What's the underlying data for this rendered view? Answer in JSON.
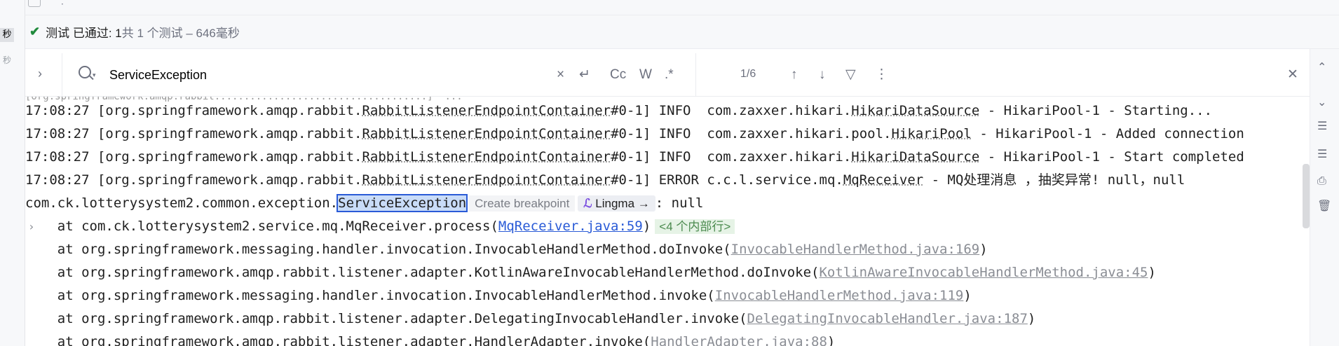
{
  "left_tabs": {
    "active": "秒",
    "inactive": "秒"
  },
  "top_toolbar": {
    "dot": "·"
  },
  "status": {
    "check_icon": "✔",
    "passed": "测试 已通过: 1",
    "detail": "共 1 个测试 – 646毫秒"
  },
  "search": {
    "expand_icon": "›",
    "query": "ServiceException",
    "clear_icon": "×",
    "wrap_icon": "↵",
    "case_label": "Cc",
    "word_label": "W",
    "regex_label": ".*",
    "match_count": "1/6",
    "prev_icon": "↑",
    "next_icon": "↓",
    "filter_icon": "▽",
    "more_icon": "⋮",
    "close_icon": "✕"
  },
  "log": {
    "lines": [
      {
        "time": "17:08:27",
        "pre": "[org.springframework.amqp.rabbit.",
        "cls": "RabbitListenerEndpointContainer",
        "post": "#0-1] ",
        "level": "INFO ",
        "logger_pre": "com.zaxxer.hikari.",
        "logger_cls": "HikariDataSource",
        "msg": " - HikariPool-1 - Starting..."
      },
      {
        "time": "17:08:27",
        "pre": "[org.springframework.amqp.rabbit.",
        "cls": "RabbitListenerEndpointContainer",
        "post": "#0-1] ",
        "level": "INFO ",
        "logger_pre": "com.zaxxer.hikari.pool.",
        "logger_cls": "HikariPool",
        "msg": " - HikariPool-1 - Added connection"
      },
      {
        "time": "17:08:27",
        "pre": "[org.springframework.amqp.rabbit.",
        "cls": "RabbitListenerEndpointContainer",
        "post": "#0-1] ",
        "level": "INFO ",
        "logger_pre": "com.zaxxer.hikari.",
        "logger_cls": "HikariDataSource",
        "msg": " - HikariPool-1 - Start completed"
      },
      {
        "time": "17:08:27",
        "pre": "[org.springframework.amqp.rabbit.",
        "cls": "RabbitListenerEndpointContainer",
        "post": "#0-1] ",
        "level": "ERROR",
        "logger_pre": "c.c.l.service.mq.",
        "logger_cls": "MqReceiver",
        "msg": " - MQ处理消息 ，抽奖异常! null，null"
      }
    ],
    "exception": {
      "pre": "com.ck.lotterysystem2.common.exception.",
      "match": "ServiceException",
      "breakpoint": "Create breakpoint",
      "lingma_icon": "ℒ",
      "lingma": "Lingma →",
      "post": ": null"
    },
    "frames": [
      {
        "at": "    at com.ck.lotterysystem2.service.mq.MqReceiver.process(",
        "src": "MqReceiver.java:59",
        "close": ")",
        "internal": "<4 个内部行>",
        "user_code": true
      },
      {
        "at": "    at org.springframework.messaging.handler.invocation.InvocableHandlerMethod.doInvoke(",
        "src": "InvocableHandlerMethod.java:169",
        "close": ")",
        "user_code": false
      },
      {
        "at": "    at org.springframework.amqp.rabbit.listener.adapter.KotlinAwareInvocableHandlerMethod.doInvoke(",
        "src": "KotlinAwareInvocableHandlerMethod.java:45",
        "close": ")",
        "user_code": false
      },
      {
        "at": "    at org.springframework.messaging.handler.invocation.InvocableHandlerMethod.invoke(",
        "src": "InvocableHandlerMethod.java:119",
        "close": ")",
        "user_code": false
      },
      {
        "at": "    at org.springframework.amqp.rabbit.listener.adapter.DelegatingInvocableHandler.invoke(",
        "src": "DelegatingInvocableHandler.java:187",
        "close": ")",
        "user_code": false
      },
      {
        "at": "    at org.springframework.amqp.rabbit.listener.adapter.HandlerAdapter.invoke(",
        "src": "HandlerAdapter.java:88",
        "close": ")",
        "user_code": false
      }
    ],
    "fold_icon": "›"
  },
  "right_icons": [
    "⌃",
    "⌄",
    "☰",
    "☰",
    "⎙",
    "🗑"
  ],
  "colors": {
    "accent": "#2a5bd7",
    "pass_green": "#208a3c",
    "highlight": "#c9dcf8"
  }
}
